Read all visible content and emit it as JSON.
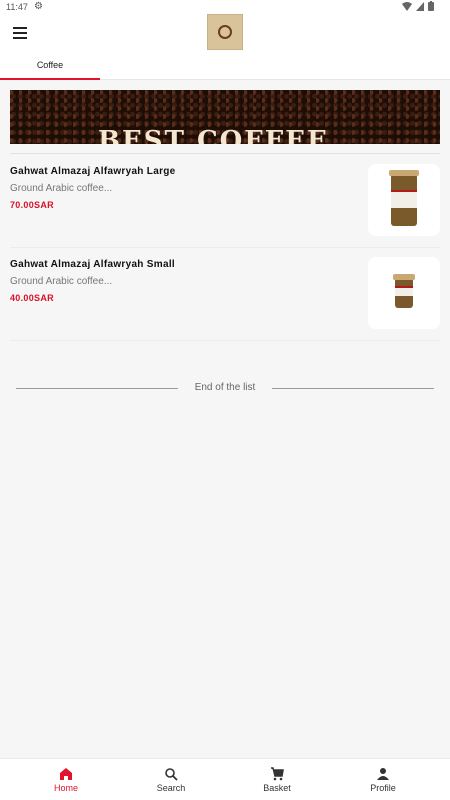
{
  "status": {
    "time": "11:47",
    "gear": "gear-icon",
    "wifi": "wifi-icon",
    "battery": "battery-icon"
  },
  "app_bar": {
    "menu_icon": "menu-icon",
    "logo": "brand-logo"
  },
  "tabs": [
    {
      "label": "Coffee",
      "active": true
    }
  ],
  "banner": {
    "text": "BEST COFFEE"
  },
  "products": [
    {
      "name": "Gahwat Almazaj Alfawryah Large",
      "description": "Ground Arabic coffee...",
      "price": "70.00SAR"
    },
    {
      "name": "Gahwat Almazaj Alfawryah Small",
      "description": "Ground Arabic coffee...",
      "price": "40.00SAR"
    }
  ],
  "end_of_list": "End of the list",
  "bottom_nav": [
    {
      "label": "Home",
      "icon": "home-icon",
      "active": true
    },
    {
      "label": "Search",
      "icon": "search-icon",
      "active": false
    },
    {
      "label": "Basket",
      "icon": "cart-icon",
      "active": false
    },
    {
      "label": "Profile",
      "icon": "person-icon",
      "active": false
    }
  ],
  "colors": {
    "accent": "#e3122b",
    "price": "#d8102a",
    "background": "#f6f6f6"
  }
}
